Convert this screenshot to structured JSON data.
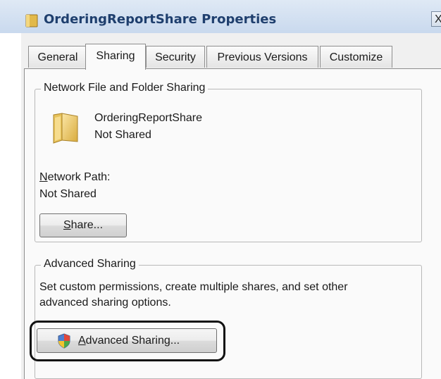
{
  "window": {
    "title": "OrderingReportShare Properties",
    "close_glyph": "X"
  },
  "tabs": [
    {
      "label": "General"
    },
    {
      "label": "Sharing"
    },
    {
      "label": "Security"
    },
    {
      "label": "Previous Versions"
    },
    {
      "label": "Customize"
    }
  ],
  "active_tab": "Sharing",
  "network_sharing": {
    "legend": "Network File and Folder Sharing",
    "folder_name": "OrderingReportShare",
    "status": "Not Shared",
    "path_label": "Network Path:",
    "path_label_accel": "N",
    "path_label_rest": "etwork Path:",
    "path_value": "Not Shared",
    "share_button": "Share...",
    "share_button_accel": "S",
    "share_button_rest": "hare..."
  },
  "advanced_sharing": {
    "legend": "Advanced Sharing",
    "description_line1": "Set custom permissions, create multiple shares, and set other",
    "description_line2": "advanced sharing options.",
    "button": "Advanced Sharing...",
    "button_accel": "A",
    "button_rest": "dvanced Sharing..."
  },
  "icons": {
    "title_icon": "folder-icon",
    "folder_icon": "folder-icon",
    "button_icon": "uac-shield-icon"
  }
}
